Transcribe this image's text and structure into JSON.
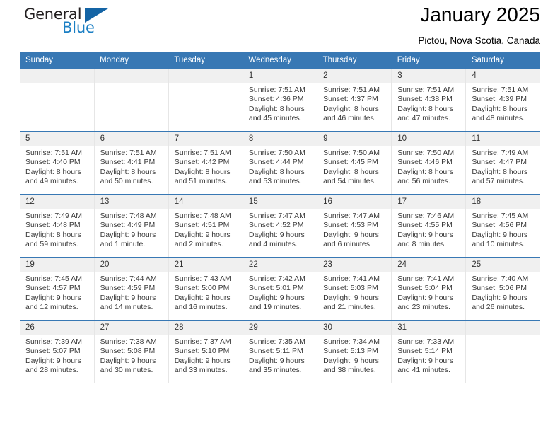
{
  "brand": {
    "name_top": "General",
    "name_bottom": "Blue",
    "accent_color": "#1464a5",
    "text_color": "#231f20"
  },
  "header": {
    "title": "January 2025",
    "subtitle": "Pictou, Nova Scotia, Canada"
  },
  "calendar": {
    "header_bg": "#3878b4",
    "daynum_bg": "#f0f0f0",
    "weekday_headers": [
      "Sunday",
      "Monday",
      "Tuesday",
      "Wednesday",
      "Thursday",
      "Friday",
      "Saturday"
    ],
    "weeks": [
      [
        {
          "day": "",
          "empty": true,
          "sunrise": "",
          "sunset": "",
          "daylight_1": "",
          "daylight_2": ""
        },
        {
          "day": "",
          "empty": true,
          "sunrise": "",
          "sunset": "",
          "daylight_1": "",
          "daylight_2": ""
        },
        {
          "day": "",
          "empty": true,
          "sunrise": "",
          "sunset": "",
          "daylight_1": "",
          "daylight_2": ""
        },
        {
          "day": "1",
          "empty": false,
          "sunrise": "Sunrise: 7:51 AM",
          "sunset": "Sunset: 4:36 PM",
          "daylight_1": "Daylight: 8 hours",
          "daylight_2": "and 45 minutes."
        },
        {
          "day": "2",
          "empty": false,
          "sunrise": "Sunrise: 7:51 AM",
          "sunset": "Sunset: 4:37 PM",
          "daylight_1": "Daylight: 8 hours",
          "daylight_2": "and 46 minutes."
        },
        {
          "day": "3",
          "empty": false,
          "sunrise": "Sunrise: 7:51 AM",
          "sunset": "Sunset: 4:38 PM",
          "daylight_1": "Daylight: 8 hours",
          "daylight_2": "and 47 minutes."
        },
        {
          "day": "4",
          "empty": false,
          "sunrise": "Sunrise: 7:51 AM",
          "sunset": "Sunset: 4:39 PM",
          "daylight_1": "Daylight: 8 hours",
          "daylight_2": "and 48 minutes."
        }
      ],
      [
        {
          "day": "5",
          "empty": false,
          "sunrise": "Sunrise: 7:51 AM",
          "sunset": "Sunset: 4:40 PM",
          "daylight_1": "Daylight: 8 hours",
          "daylight_2": "and 49 minutes."
        },
        {
          "day": "6",
          "empty": false,
          "sunrise": "Sunrise: 7:51 AM",
          "sunset": "Sunset: 4:41 PM",
          "daylight_1": "Daylight: 8 hours",
          "daylight_2": "and 50 minutes."
        },
        {
          "day": "7",
          "empty": false,
          "sunrise": "Sunrise: 7:51 AM",
          "sunset": "Sunset: 4:42 PM",
          "daylight_1": "Daylight: 8 hours",
          "daylight_2": "and 51 minutes."
        },
        {
          "day": "8",
          "empty": false,
          "sunrise": "Sunrise: 7:50 AM",
          "sunset": "Sunset: 4:44 PM",
          "daylight_1": "Daylight: 8 hours",
          "daylight_2": "and 53 minutes."
        },
        {
          "day": "9",
          "empty": false,
          "sunrise": "Sunrise: 7:50 AM",
          "sunset": "Sunset: 4:45 PM",
          "daylight_1": "Daylight: 8 hours",
          "daylight_2": "and 54 minutes."
        },
        {
          "day": "10",
          "empty": false,
          "sunrise": "Sunrise: 7:50 AM",
          "sunset": "Sunset: 4:46 PM",
          "daylight_1": "Daylight: 8 hours",
          "daylight_2": "and 56 minutes."
        },
        {
          "day": "11",
          "empty": false,
          "sunrise": "Sunrise: 7:49 AM",
          "sunset": "Sunset: 4:47 PM",
          "daylight_1": "Daylight: 8 hours",
          "daylight_2": "and 57 minutes."
        }
      ],
      [
        {
          "day": "12",
          "empty": false,
          "sunrise": "Sunrise: 7:49 AM",
          "sunset": "Sunset: 4:48 PM",
          "daylight_1": "Daylight: 8 hours",
          "daylight_2": "and 59 minutes."
        },
        {
          "day": "13",
          "empty": false,
          "sunrise": "Sunrise: 7:48 AM",
          "sunset": "Sunset: 4:49 PM",
          "daylight_1": "Daylight: 9 hours",
          "daylight_2": "and 1 minute."
        },
        {
          "day": "14",
          "empty": false,
          "sunrise": "Sunrise: 7:48 AM",
          "sunset": "Sunset: 4:51 PM",
          "daylight_1": "Daylight: 9 hours",
          "daylight_2": "and 2 minutes."
        },
        {
          "day": "15",
          "empty": false,
          "sunrise": "Sunrise: 7:47 AM",
          "sunset": "Sunset: 4:52 PM",
          "daylight_1": "Daylight: 9 hours",
          "daylight_2": "and 4 minutes."
        },
        {
          "day": "16",
          "empty": false,
          "sunrise": "Sunrise: 7:47 AM",
          "sunset": "Sunset: 4:53 PM",
          "daylight_1": "Daylight: 9 hours",
          "daylight_2": "and 6 minutes."
        },
        {
          "day": "17",
          "empty": false,
          "sunrise": "Sunrise: 7:46 AM",
          "sunset": "Sunset: 4:55 PM",
          "daylight_1": "Daylight: 9 hours",
          "daylight_2": "and 8 minutes."
        },
        {
          "day": "18",
          "empty": false,
          "sunrise": "Sunrise: 7:45 AM",
          "sunset": "Sunset: 4:56 PM",
          "daylight_1": "Daylight: 9 hours",
          "daylight_2": "and 10 minutes."
        }
      ],
      [
        {
          "day": "19",
          "empty": false,
          "sunrise": "Sunrise: 7:45 AM",
          "sunset": "Sunset: 4:57 PM",
          "daylight_1": "Daylight: 9 hours",
          "daylight_2": "and 12 minutes."
        },
        {
          "day": "20",
          "empty": false,
          "sunrise": "Sunrise: 7:44 AM",
          "sunset": "Sunset: 4:59 PM",
          "daylight_1": "Daylight: 9 hours",
          "daylight_2": "and 14 minutes."
        },
        {
          "day": "21",
          "empty": false,
          "sunrise": "Sunrise: 7:43 AM",
          "sunset": "Sunset: 5:00 PM",
          "daylight_1": "Daylight: 9 hours",
          "daylight_2": "and 16 minutes."
        },
        {
          "day": "22",
          "empty": false,
          "sunrise": "Sunrise: 7:42 AM",
          "sunset": "Sunset: 5:01 PM",
          "daylight_1": "Daylight: 9 hours",
          "daylight_2": "and 19 minutes."
        },
        {
          "day": "23",
          "empty": false,
          "sunrise": "Sunrise: 7:41 AM",
          "sunset": "Sunset: 5:03 PM",
          "daylight_1": "Daylight: 9 hours",
          "daylight_2": "and 21 minutes."
        },
        {
          "day": "24",
          "empty": false,
          "sunrise": "Sunrise: 7:41 AM",
          "sunset": "Sunset: 5:04 PM",
          "daylight_1": "Daylight: 9 hours",
          "daylight_2": "and 23 minutes."
        },
        {
          "day": "25",
          "empty": false,
          "sunrise": "Sunrise: 7:40 AM",
          "sunset": "Sunset: 5:06 PM",
          "daylight_1": "Daylight: 9 hours",
          "daylight_2": "and 26 minutes."
        }
      ],
      [
        {
          "day": "26",
          "empty": false,
          "sunrise": "Sunrise: 7:39 AM",
          "sunset": "Sunset: 5:07 PM",
          "daylight_1": "Daylight: 9 hours",
          "daylight_2": "and 28 minutes."
        },
        {
          "day": "27",
          "empty": false,
          "sunrise": "Sunrise: 7:38 AM",
          "sunset": "Sunset: 5:08 PM",
          "daylight_1": "Daylight: 9 hours",
          "daylight_2": "and 30 minutes."
        },
        {
          "day": "28",
          "empty": false,
          "sunrise": "Sunrise: 7:37 AM",
          "sunset": "Sunset: 5:10 PM",
          "daylight_1": "Daylight: 9 hours",
          "daylight_2": "and 33 minutes."
        },
        {
          "day": "29",
          "empty": false,
          "sunrise": "Sunrise: 7:35 AM",
          "sunset": "Sunset: 5:11 PM",
          "daylight_1": "Daylight: 9 hours",
          "daylight_2": "and 35 minutes."
        },
        {
          "day": "30",
          "empty": false,
          "sunrise": "Sunrise: 7:34 AM",
          "sunset": "Sunset: 5:13 PM",
          "daylight_1": "Daylight: 9 hours",
          "daylight_2": "and 38 minutes."
        },
        {
          "day": "31",
          "empty": false,
          "sunrise": "Sunrise: 7:33 AM",
          "sunset": "Sunset: 5:14 PM",
          "daylight_1": "Daylight: 9 hours",
          "daylight_2": "and 41 minutes."
        },
        {
          "day": "",
          "empty": true,
          "sunrise": "",
          "sunset": "",
          "daylight_1": "",
          "daylight_2": ""
        }
      ]
    ]
  }
}
